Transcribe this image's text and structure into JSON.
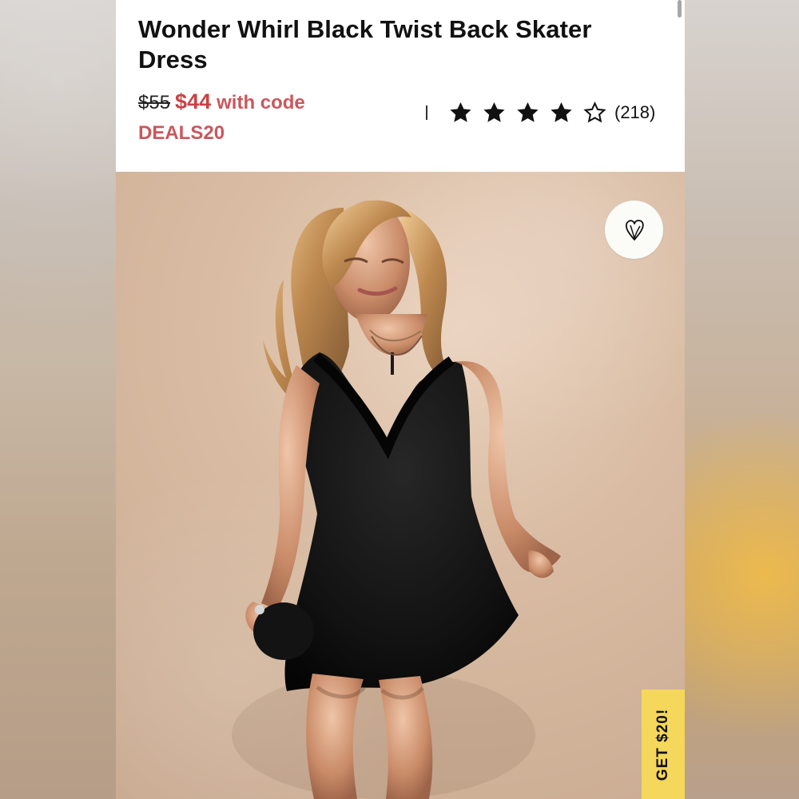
{
  "product": {
    "title": "Wonder Whirl Black Twist Back Skater Dress",
    "original_price": "$55",
    "sale_price": "$44",
    "code_text": "with code",
    "promo_code": "DEALS20"
  },
  "rating": {
    "stars": 4,
    "max_stars": 5,
    "count": "(218)"
  },
  "image": {
    "description_icon": "dress-model-photo"
  },
  "actions": {
    "wishlist_icon": "heart-outline-icon",
    "promo_tab_label": "GET $20!"
  },
  "colors": {
    "sale_red": "#c84245",
    "promo_yellow": "#f4d75b",
    "background_tan": "#d9bca3"
  }
}
